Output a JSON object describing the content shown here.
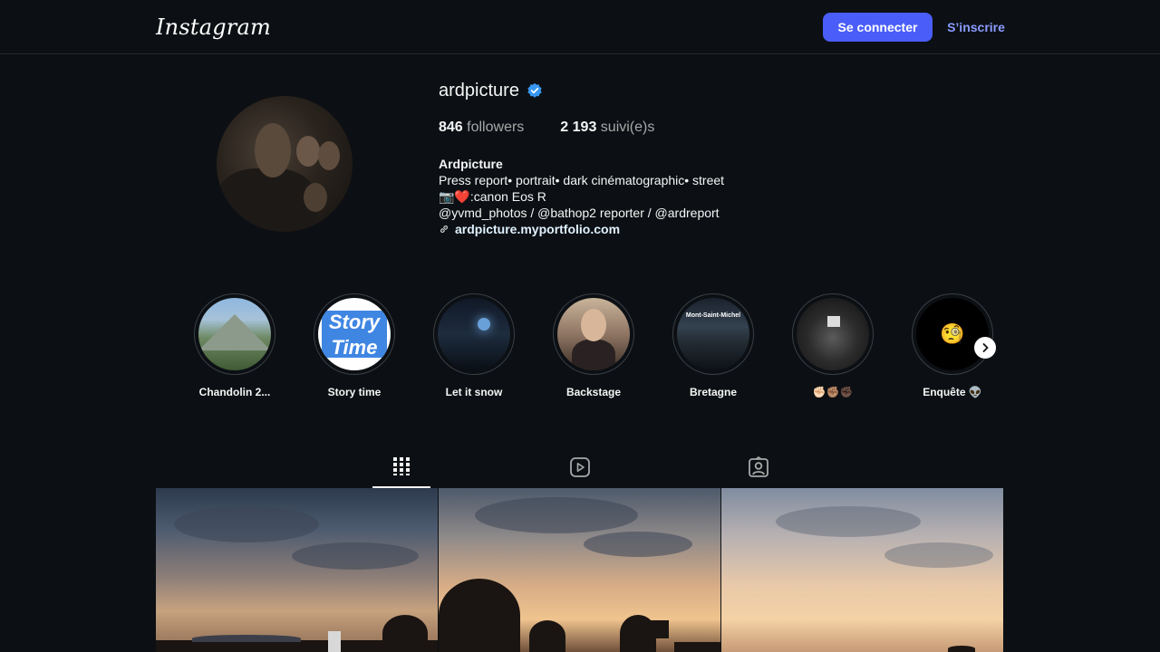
{
  "header": {
    "logo": "Instagram",
    "login_label": "Se connecter",
    "signup_label": "S’inscrire"
  },
  "profile": {
    "username": "ardpicture",
    "verified": true,
    "followers_count": "846",
    "followers_label": "followers",
    "following_count": "2 193",
    "following_label": "suivi(e)s",
    "display_name": "Ardpicture",
    "bio_lines": [
      "Press report• portrait• dark cinématographic• street",
      "📷❤️:canon Eos R",
      "@yvmd_photos / @bathop2 reporter / @ardreport"
    ],
    "link": "ardpicture.myportfolio.com"
  },
  "highlights": [
    {
      "label": "Chandolin 2..."
    },
    {
      "label": "Story time",
      "thumb_text_1": "Story",
      "thumb_text_2": "Time"
    },
    {
      "label": "Let it snow"
    },
    {
      "label": "Backstage"
    },
    {
      "label": "Bretagne",
      "thumb_text": "Mont-Saint-Michel"
    },
    {
      "label": "✊🏻✊🏽✊🏿"
    },
    {
      "label": "Enquête 👽",
      "thumb_emoji": "🧐"
    }
  ],
  "tabs": [
    {
      "name": "grid",
      "icon": "grid-icon",
      "active": true
    },
    {
      "name": "reels",
      "icon": "reels-icon",
      "active": false
    },
    {
      "name": "tagged",
      "icon": "tagged-icon",
      "active": false
    }
  ],
  "colors": {
    "background": "#0c1014",
    "primary_button": "#4a5df9",
    "signup_link": "#8a9bff",
    "verified": "#3897f0"
  }
}
